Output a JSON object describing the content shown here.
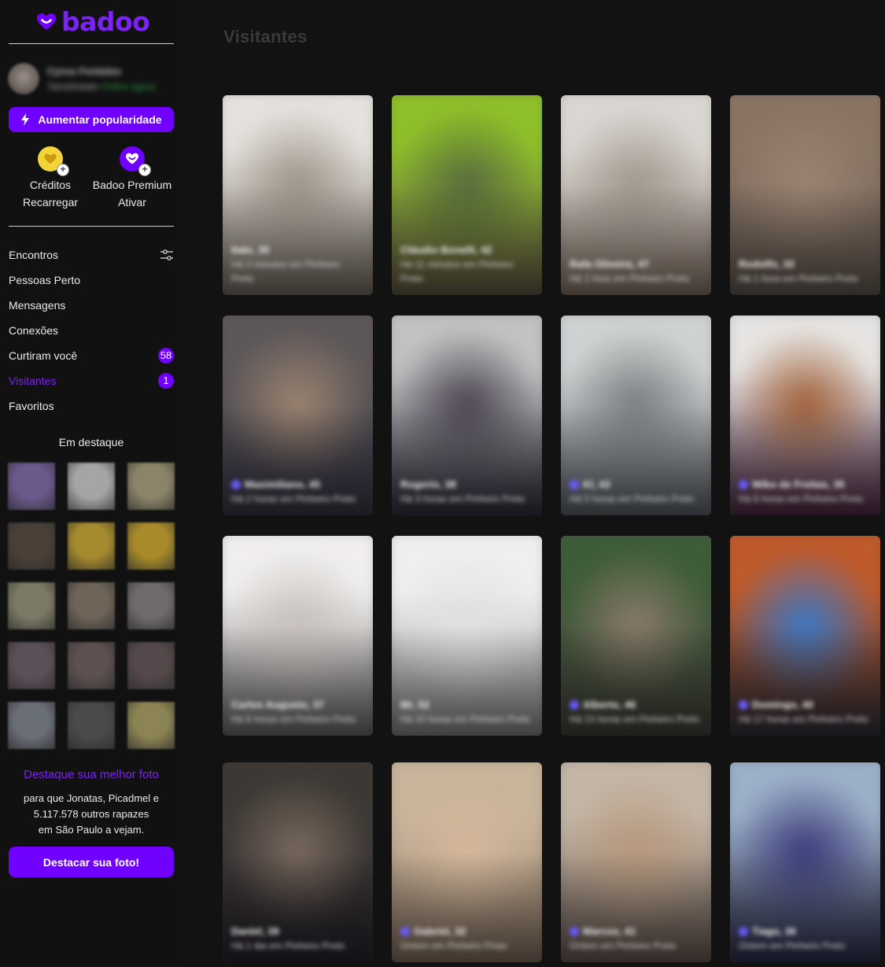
{
  "brand": {
    "name": "badoo",
    "color": "#7000ff",
    "icon": "badoo-heart-logo-icon"
  },
  "profile": {
    "name": "Cyrus Fonteles",
    "status": "Tamañelado",
    "online": "Online agora"
  },
  "boost_button": {
    "label": "Aumentar popularidade",
    "icon": "lightning-icon"
  },
  "features": [
    {
      "title": "Créditos",
      "action": "Recarregar",
      "icon": "credits-coin-icon"
    },
    {
      "title": "Badoo Premium",
      "action": "Ativar",
      "icon": "premium-heart-icon"
    }
  ],
  "nav": [
    {
      "label": "Encontros",
      "icon": "filter-sliders-icon"
    },
    {
      "label": "Pessoas Perto"
    },
    {
      "label": "Mensagens"
    },
    {
      "label": "Conexões"
    },
    {
      "label": "Curtiram você",
      "badge": "58"
    },
    {
      "label": "Visitantes",
      "badge": "1",
      "active": true
    },
    {
      "label": "Favoritos"
    }
  ],
  "featured": {
    "title": "Em destaque",
    "thumb_colors": [
      "#6a5a8c",
      "#a4a6a6",
      "#8c8468",
      "#4a4038",
      "#a58a2e",
      "#a88a2a",
      "#7c7a64",
      "#6e6458",
      "#706a6c",
      "#5c5058",
      "#5c5050",
      "#54484a",
      "#6a6e76",
      "#4a4a4c",
      "#8c8454"
    ]
  },
  "promo": {
    "link": "Destaque sua melhor foto",
    "line1": "para que Jonatas, Picadmel e",
    "line2": "5.117.578 outros rapazes",
    "line3": "em São Paulo a vejam.",
    "button": "Destacar sua foto!"
  },
  "main": {
    "title": "Visitantes"
  },
  "visitors": [
    {
      "name": "Italo, 35",
      "distance": "Há 3 minutos em Pinheiro Preto",
      "verified": false,
      "photo": [
        "#e5e2de",
        "#9c9488",
        "#7a6e62"
      ]
    },
    {
      "name": "Cláudio Bonelli, 42",
      "distance": "Há 11 minutos em Pinheiro Preto",
      "verified": false,
      "photo": [
        "#8fbf2a",
        "#566b3c",
        "#6a5a50"
      ]
    },
    {
      "name": "Rafa Oliveira, 47",
      "distance": "Há 1 hora em Pinheiro Preto",
      "verified": false,
      "photo": [
        "#dad6d2",
        "#a0978c",
        "#8d7a6a"
      ]
    },
    {
      "name": "Rodolfo, 33",
      "distance": "Há 1 hora em Pinheiro Preto",
      "verified": false,
      "photo": [
        "#8a7464",
        "#9a8472",
        "#6a6058"
      ]
    },
    {
      "name": "Maximiliano, 45",
      "distance": "Há 2 horas em Pinheiro Preto",
      "verified": true,
      "photo": [
        "#5c5658",
        "#9c8470",
        "#3a3a4a"
      ]
    },
    {
      "name": "Rogerio, 38",
      "distance": "Há 3 horas em Pinheiro Preto",
      "verified": false,
      "photo": [
        "#c2c2c2",
        "#4a4450",
        "#2a2838"
      ]
    },
    {
      "name": "Kl, 43",
      "distance": "Há 5 horas em Pinheiro Preto",
      "verified": true,
      "photo": [
        "#cfd2d2",
        "#7a7e80",
        "#5c646c"
      ]
    },
    {
      "name": "Wiko de Freitas, 35",
      "distance": "Há 6 horas em Pinheiro Preto",
      "verified": true,
      "photo": [
        "#e6e4e2",
        "#a06038",
        "#4a2240"
      ]
    },
    {
      "name": "Carlos Augusto, 37",
      "distance": "Há 8 horas em Pinheiro Preto",
      "verified": false,
      "photo": [
        "#f0efee",
        "#c6c0bc",
        "#6e6a6a"
      ]
    },
    {
      "name": "Mr, 52",
      "distance": "Há 10 horas em Pinheiro Preto",
      "verified": false,
      "photo": [
        "#efefef",
        "#e0e0e0",
        "#8a8a8a"
      ]
    },
    {
      "name": "Alberto, 46",
      "distance": "Há 13 horas em Pinheiro Preto",
      "verified": true,
      "photo": [
        "#3e5c38",
        "#8a7a6a",
        "#4a4440"
      ]
    },
    {
      "name": "Domingo, 40",
      "distance": "Há 17 horas em Pinheiro Preto",
      "verified": true,
      "photo": [
        "#c05a2a",
        "#3a78c8",
        "#2a3040"
      ]
    },
    {
      "name": "Daniel, 39",
      "distance": "Há 1 dia em Pinheiro Preto",
      "verified": false,
      "photo": [
        "#3c3834",
        "#7a6a5e",
        "#2a2630"
      ]
    },
    {
      "name": "Gabriel, 32",
      "distance": "Ontem em Pinheiro Preto",
      "verified": true,
      "photo": [
        "#c8b49a",
        "#d6b89c",
        "#8a7464"
      ]
    },
    {
      "name": "Marcos, 41",
      "distance": "Ontem em Pinheiro Preto",
      "verified": true,
      "photo": [
        "#c4b6a6",
        "#b8987c",
        "#6a5a52"
      ]
    },
    {
      "name": "Tiago, 36",
      "distance": "Ontem em Pinheiro Preto",
      "verified": true,
      "photo": [
        "#9cb0c8",
        "#3a3a7a",
        "#2a2a4a"
      ]
    }
  ]
}
